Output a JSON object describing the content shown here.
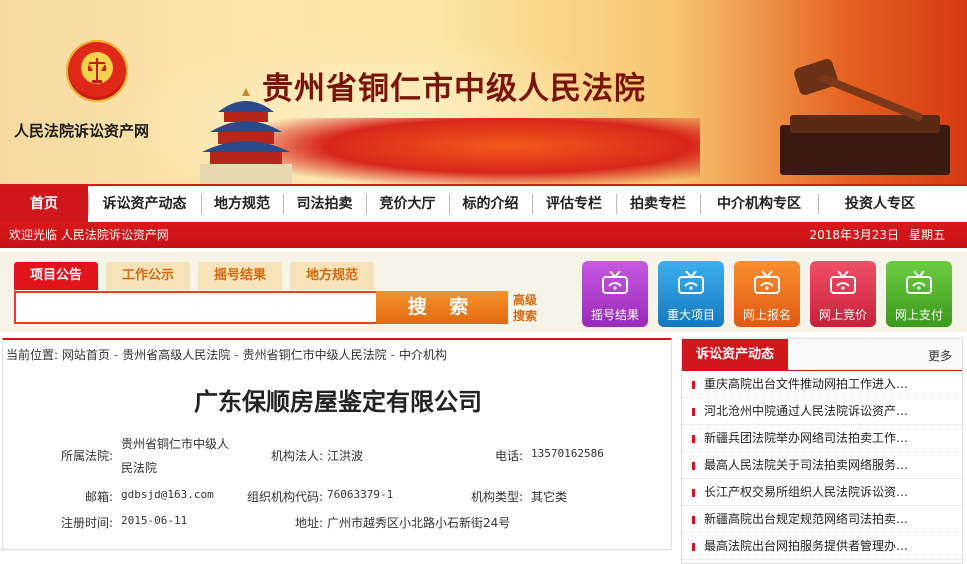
{
  "banner": {
    "site_name": "人民法院诉讼资产网",
    "court_title": "贵州省铜仁市中级人民法院"
  },
  "nav": {
    "items": [
      {
        "label": "首页",
        "active": true
      },
      {
        "label": "诉讼资产动态"
      },
      {
        "label": "地方规范"
      },
      {
        "label": "司法拍卖"
      },
      {
        "label": "竞价大厅"
      },
      {
        "label": "标的介绍"
      },
      {
        "label": "评估专栏"
      },
      {
        "label": "拍卖专栏"
      },
      {
        "label": "中介机构专区"
      },
      {
        "label": "投资人专区"
      }
    ]
  },
  "welcome": {
    "text": "欢迎光临 人民法院诉讼资产网",
    "date": "2018年3月23日",
    "weekday": "星期五"
  },
  "search": {
    "tabs": [
      {
        "label": "项目公告",
        "active": true
      },
      {
        "label": "工作公示"
      },
      {
        "label": "摇号结果"
      },
      {
        "label": "地方规范"
      }
    ],
    "query": "",
    "button_label": "搜 索",
    "advanced_label": "高级搜索"
  },
  "quick_links": [
    {
      "label": "摇号结果",
      "color": "#b23bd0",
      "icon": "tv-icon"
    },
    {
      "label": "重大项目",
      "color": "#1a93d8",
      "icon": "tv-icon"
    },
    {
      "label": "网上报名",
      "color": "#f06a16",
      "icon": "tv-icon"
    },
    {
      "label": "网上竞价",
      "color": "#e0304a",
      "icon": "tv-icon"
    },
    {
      "label": "网上支付",
      "color": "#4cb62a",
      "icon": "tv-icon"
    }
  ],
  "breadcrumb": {
    "prefix": "当前位置:",
    "items": [
      "网站首页",
      "贵州省高级人民法院",
      "贵州省铜仁市中级人民法院",
      "中介机构"
    ]
  },
  "company": {
    "name": "广东保顺房屋鉴定有限公司",
    "court_label": "所属法院:",
    "court_line1": "贵州省铜仁市中级人",
    "court_line2": "民法院",
    "legal_label": "机构法人:",
    "legal_value": "江洪波",
    "phone_label": "电话:",
    "phone_value": "13570162586",
    "email_label": "邮箱:",
    "email_value": "gdbsjd@163.com",
    "org_code_label": "组织机构代码:",
    "org_code_value": "76063379-1",
    "type_label": "机构类型:",
    "type_value": "其它类",
    "reg_label": "注册时间:",
    "reg_value": "2015-06-11",
    "addr_label": "地址:",
    "addr_value": "广州市越秀区小北路小石新街24号"
  },
  "sidebar": {
    "title": "诉讼资产动态",
    "more": "更多",
    "items": [
      "重庆高院出台文件推动网拍工作进入…",
      "河北沧州中院通过人民法院诉讼资产…",
      "新疆兵团法院举办网络司法拍卖工作…",
      "最高人民法院关于司法拍卖网络服务…",
      "长江产权交易所组织人民法院诉讼资…",
      "新疆高院出台规定规范网络司法拍卖…",
      "最高法院出台网拍服务提供者管理办…"
    ]
  }
}
